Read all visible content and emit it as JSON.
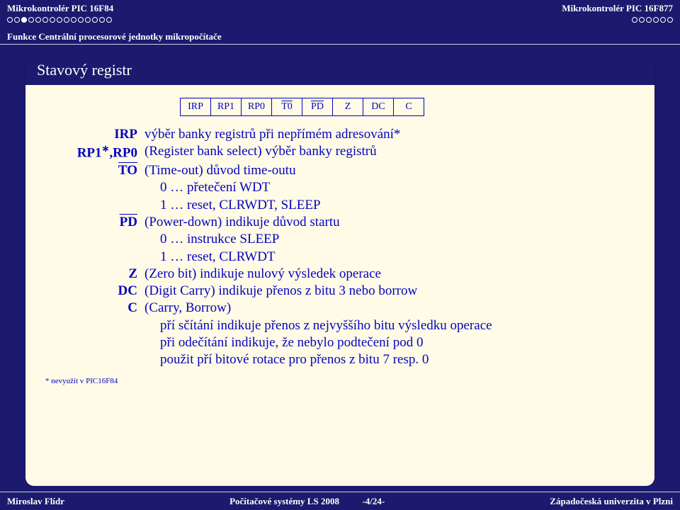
{
  "header": {
    "left_title": "Mikrokontrolér PIC 16F84",
    "right_title": "Mikrokontrolér PIC 16F877",
    "subsection": "Funkce Centrální procesorové jednotky mikropočítače",
    "left_dots_total": 15,
    "left_dots_filled_index": 2,
    "right_dots_total": 6
  },
  "block_title": "Stavový registr",
  "register_bits": [
    "IRP",
    "RP1",
    "RP0",
    "T0",
    "PD",
    "Z",
    "DC",
    "C"
  ],
  "register_overline": [
    false,
    false,
    false,
    true,
    true,
    false,
    false,
    false
  ],
  "defs": [
    {
      "term": "IRP",
      "overline": false,
      "star": false,
      "lines": [
        "výběr banky registrů při nepřímém adresování*"
      ]
    },
    {
      "term": "RP1*,RP0",
      "overline": false,
      "star": true,
      "lines": [
        "(Register bank select) výběr banky registrů"
      ]
    },
    {
      "term": "TO",
      "overline": true,
      "star": false,
      "lines": [
        "(Time-out) důvod time-outu",
        "0 … přetečení WDT",
        "1 … reset, CLRWDT, SLEEP"
      ]
    },
    {
      "term": "PD",
      "overline": true,
      "star": false,
      "lines": [
        "(Power-down) indikuje důvod startu",
        "0 … instrukce SLEEP",
        "1 … reset, CLRWDT"
      ]
    },
    {
      "term": "Z",
      "overline": false,
      "star": false,
      "lines": [
        "(Zero bit) indikuje nulový výsledek operace"
      ]
    },
    {
      "term": "DC",
      "overline": false,
      "star": false,
      "lines": [
        "(Digit Carry) indikuje přenos z bitu 3 nebo borrow"
      ]
    },
    {
      "term": "C",
      "overline": false,
      "star": false,
      "lines": [
        "(Carry, Borrow)",
        "pří sčítání indikuje přenos z nejvyššího bitu výsledku operace",
        "při odečítání indikuje, že nebylo podtečení pod 0",
        "použit pří bitové rotace pro přenos z bitu 7 resp. 0"
      ]
    }
  ],
  "footnote": "* nevyužit v PIC16F84",
  "footer": {
    "left": "Miroslav Flídr",
    "center": "Počítačové systémy LS 2008",
    "page": "-4/24-",
    "right": "Západočeská univerzita v Plzni"
  }
}
